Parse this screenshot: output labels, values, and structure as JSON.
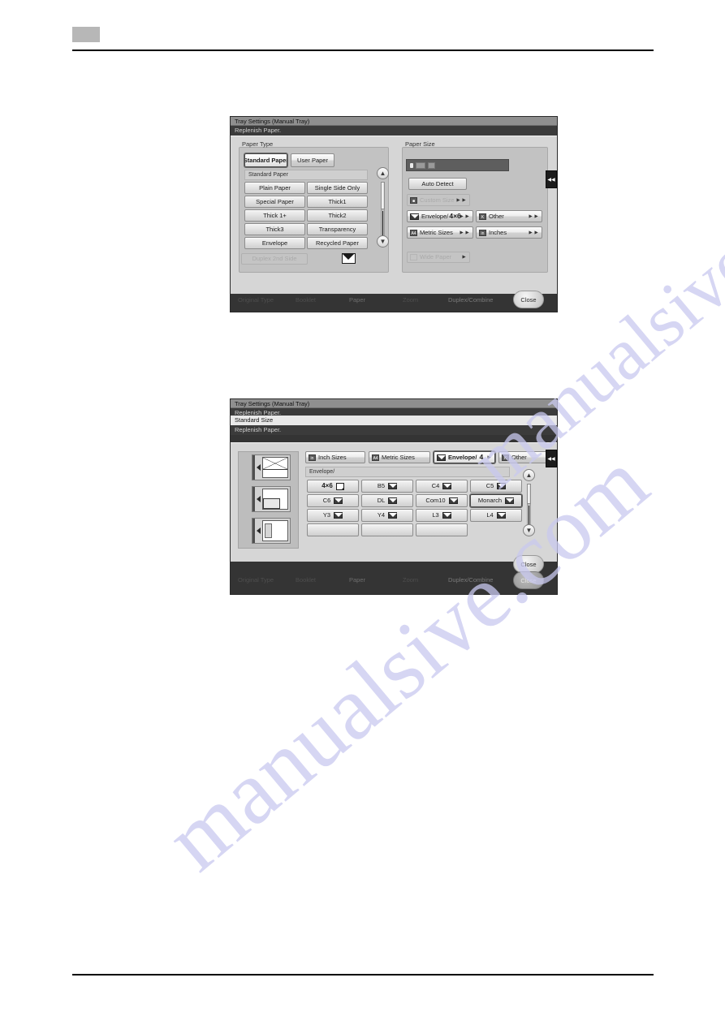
{
  "page": {
    "watermark": [
      "manualsive.com",
      "manualsive.com"
    ]
  },
  "panel1": {
    "title": "Tray Settings (Manual Tray)",
    "status": "Replenish Paper.",
    "paper_type": {
      "group_label": "Paper Type",
      "tabs": [
        {
          "label": "Standard Paper",
          "selected": true
        },
        {
          "label": "User Paper",
          "selected": false
        }
      ],
      "list_header": "Standard Paper",
      "items": [
        "Plain Paper",
        "Single Side Only",
        "Special Paper",
        "Thick1",
        "Thick 1+",
        "Thick2",
        "Thick3",
        "Transparency",
        "Envelope",
        "Recycled Paper"
      ],
      "duplex_button": {
        "label": "Duplex 2nd Side",
        "enabled": false
      },
      "envelope_icon": "envelope-icon",
      "scroll_up": "▲",
      "scroll_down": "▼"
    },
    "paper_size": {
      "group_label": "Paper Size",
      "auto_detect": "Auto Detect",
      "custom_size": {
        "label": "Custom Size",
        "enabled": false
      },
      "categories": [
        {
          "label": "Envelope/",
          "value": "4×6",
          "icon": "envelope-icon",
          "selected": false
        },
        {
          "label": "Other",
          "value": "",
          "icon": "other-icon",
          "selected": false
        },
        {
          "label": "Metric Sizes",
          "value": "",
          "icon": "a4-icon",
          "selected": false
        },
        {
          "label": "Inches",
          "value": "",
          "icon": "inch-icon",
          "selected": false
        }
      ],
      "wide_paper": {
        "label": "Wide Paper",
        "enabled": false
      }
    },
    "collapse_icon": "◀◀",
    "close_label": "Close",
    "ghost_tabs": [
      "Original Type",
      "Booklet",
      "Paper",
      "Zoom",
      "Duplex/Combine"
    ]
  },
  "panel2": {
    "title": "Tray Settings (Manual Tray)",
    "status_behind": "Replenish Paper.",
    "subtitle": "Standard Size",
    "status": "Replenish Paper.",
    "orientation_items": [
      "envelope-orientation",
      "fold-orientation",
      "label-orientation"
    ],
    "size_tabs": [
      {
        "label": "Inch Sizes",
        "icon": "inch-icon",
        "selected": false
      },
      {
        "label": "Metric Sizes",
        "icon": "a4-icon",
        "selected": false
      },
      {
        "label": "Envelope/",
        "value": "4",
        "icon": "envelope-icon",
        "selected": true
      },
      {
        "label": "Other",
        "icon": "other-icon",
        "selected": false
      }
    ],
    "list_header": "Envelope/",
    "sizes": [
      {
        "label": "4×6",
        "icon": "page-icon",
        "selected": false
      },
      {
        "label": "B5",
        "icon": "envelope-icon",
        "selected": false
      },
      {
        "label": "C4",
        "icon": "envelope-icon",
        "selected": false
      },
      {
        "label": "C5",
        "icon": "envelope-icon",
        "selected": false
      },
      {
        "label": "C6",
        "icon": "envelope-icon",
        "selected": false
      },
      {
        "label": "DL",
        "icon": "envelope-icon",
        "selected": false
      },
      {
        "label": "Com10",
        "icon": "envelope-icon",
        "selected": false
      },
      {
        "label": "Monarch",
        "icon": "envelope-icon",
        "selected": true
      },
      {
        "label": "Y3",
        "icon": "envelope-icon",
        "selected": false
      },
      {
        "label": "Y4",
        "icon": "envelope-icon",
        "selected": false
      },
      {
        "label": "L3",
        "icon": "envelope-icon",
        "selected": false
      },
      {
        "label": "L4",
        "icon": "envelope-icon",
        "selected": false
      }
    ],
    "collapse_icon": "◀◀",
    "close_label": "Close",
    "close_label_behind": "Close",
    "scroll_up": "▲",
    "scroll_down": "▼",
    "ghost_tabs": [
      "Original Type",
      "Booklet",
      "Paper",
      "Zoom",
      "Duplex/Combine"
    ]
  }
}
